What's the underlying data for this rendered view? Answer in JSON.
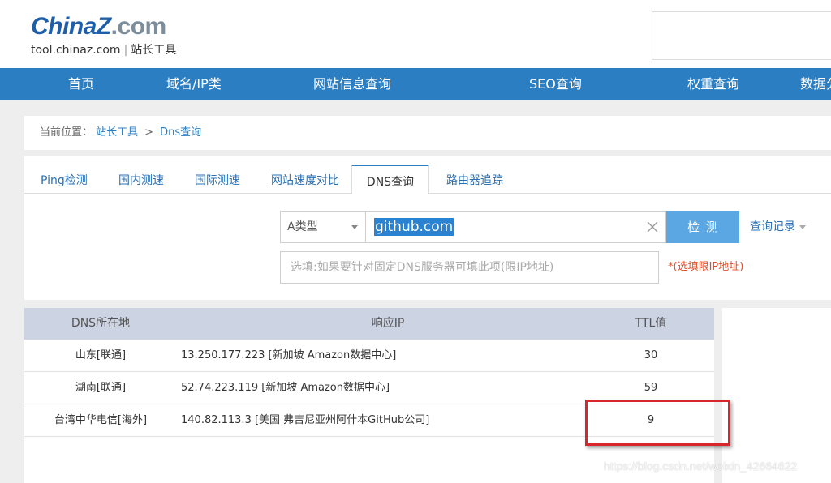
{
  "header": {
    "logo_part1": "China",
    "logo_part2": "Z",
    "logo_part3": ".com",
    "logo_sub_domain": "tool.chinaz.com",
    "logo_sub_sep": "|",
    "logo_sub_name": "站长工具"
  },
  "nav": {
    "items": [
      {
        "label": "首页"
      },
      {
        "label": "域名/IP类"
      },
      {
        "label": "网站信息查询"
      },
      {
        "label": "SEO查询"
      },
      {
        "label": "权重查询"
      },
      {
        "label": "数据分"
      }
    ]
  },
  "breadcrumb": {
    "prefix": "当前位置：",
    "home": "站长工具",
    "arrow": ">",
    "current": "Dns查询"
  },
  "tabs": [
    {
      "label": "Ping检测"
    },
    {
      "label": "国内测速"
    },
    {
      "label": "国际测速"
    },
    {
      "label": "网站速度对比"
    },
    {
      "label": "DNS查询",
      "active": true
    },
    {
      "label": "路由器追踪"
    }
  ],
  "query": {
    "record_type": "A类型",
    "domain_value": "github.com",
    "submit_label": "检测",
    "history_label": "查询记录",
    "server_placeholder": "选填:如果要针对固定DNS服务器可填此项(限IP地址)",
    "server_note": "*(选填限IP地址)"
  },
  "results": {
    "columns": {
      "location": "DNS所在地",
      "ip": "响应IP",
      "ttl": "TTL值"
    },
    "rows": [
      {
        "location": "山东[联通]",
        "ip": "13.250.177.223 [新加坡 Amazon数据中心]",
        "ttl": "30"
      },
      {
        "location": "湖南[联通]",
        "ip": "52.74.223.119 [新加坡 Amazon数据中心]",
        "ttl": "59"
      },
      {
        "location": "台湾中华电信[海外]",
        "ip": "140.82.113.3 [美国 弗吉尼亚州阿什本GitHub公司]",
        "ttl": "9"
      }
    ]
  },
  "watermark": "https://blog.csdn.net/weixin_42664622",
  "colors": {
    "nav_bg": "#2b7ec1",
    "button_bg": "#5aa7e3",
    "highlight_border": "#d9262c",
    "table_header_bg": "#ccd3e2"
  }
}
